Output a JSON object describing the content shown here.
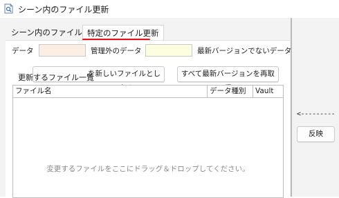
{
  "window": {
    "title": "シーン内のファイル更新"
  },
  "tabs": [
    {
      "label": "シーン内のファイル更新",
      "active": false
    },
    {
      "label": "特定のファイル更新",
      "active": true
    }
  ],
  "legend": {
    "data_label": "データ",
    "data_color": "#fdeee4",
    "unmanaged_label": "管理外のデータ",
    "unmanaged_color": "#fdfde0",
    "outdated_label": "最新バージョンでないデータ"
  },
  "buttons": {
    "treat_as_new": "選択ファイルを新しいファイルとして扱う",
    "treat_as_new_visible": "を新しいファイルとして扱う",
    "reacquire_latest": "すべて最新バージョンを再取得",
    "apply": "反映"
  },
  "list": {
    "title": "更新するファイル一覧",
    "columns": [
      "ファイル名",
      "データ種別",
      "Vault"
    ],
    "placeholder": "変更するファイルをここにドラッグ＆ドロップしてください。"
  },
  "side": {
    "arrow_text": "<---------"
  },
  "colors": {
    "accent_underline": "#e8101a"
  },
  "icons": {
    "app": "file-search-icon"
  }
}
